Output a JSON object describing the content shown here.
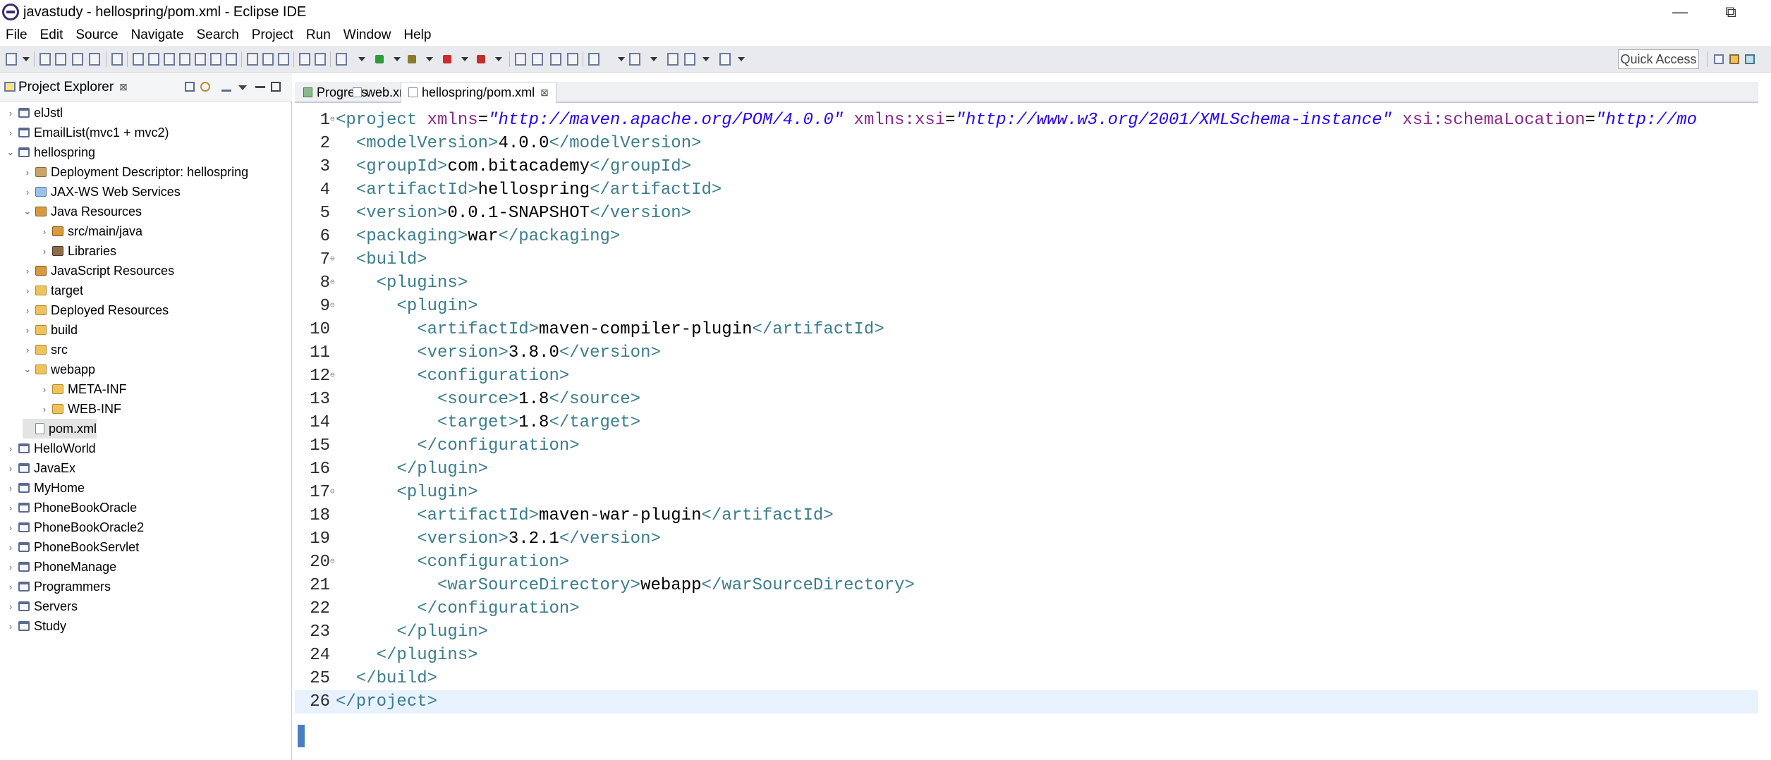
{
  "window": {
    "title": "javastudy - hellospring/pom.xml - Eclipse IDE",
    "minimize_glyph": "—",
    "restore_glyph": "⧉"
  },
  "menu": [
    "File",
    "Edit",
    "Source",
    "Navigate",
    "Search",
    "Project",
    "Run",
    "Window",
    "Help"
  ],
  "toolbar": {
    "quick_access": "Quick Access"
  },
  "explorer": {
    "title": "Project Explorer",
    "close_glyph": "⊠",
    "items": [
      {
        "label": "elJstl",
        "depth": 0,
        "expanded": false,
        "icon": "project-icon"
      },
      {
        "label": "EmailList(mvc1 + mvc2)",
        "depth": 0,
        "expanded": false,
        "icon": "project-icon"
      },
      {
        "label": "hellospring",
        "depth": 0,
        "expanded": true,
        "icon": "project-icon"
      },
      {
        "label": "Deployment Descriptor: hellospring",
        "depth": 1,
        "expanded": false,
        "icon": "deployment-descriptor-icon"
      },
      {
        "label": "JAX-WS Web Services",
        "depth": 1,
        "expanded": false,
        "icon": "web-services-icon"
      },
      {
        "label": "Java Resources",
        "depth": 1,
        "expanded": true,
        "icon": "java-resources-icon"
      },
      {
        "label": "src/main/java",
        "depth": 2,
        "expanded": false,
        "icon": "source-folder-icon"
      },
      {
        "label": "Libraries",
        "depth": 2,
        "expanded": false,
        "icon": "libraries-icon"
      },
      {
        "label": "JavaScript Resources",
        "depth": 1,
        "expanded": false,
        "icon": "javascript-resources-icon"
      },
      {
        "label": "target",
        "depth": 1,
        "expanded": false,
        "icon": "folder-icon"
      },
      {
        "label": "Deployed Resources",
        "depth": 1,
        "expanded": false,
        "icon": "deployed-resources-icon"
      },
      {
        "label": "build",
        "depth": 1,
        "expanded": false,
        "icon": "folder-icon"
      },
      {
        "label": "src",
        "depth": 1,
        "expanded": false,
        "icon": "folder-icon"
      },
      {
        "label": "webapp",
        "depth": 1,
        "expanded": true,
        "icon": "folder-icon"
      },
      {
        "label": "META-INF",
        "depth": 2,
        "expanded": false,
        "icon": "folder-icon"
      },
      {
        "label": "WEB-INF",
        "depth": 2,
        "expanded": false,
        "icon": "folder-icon"
      },
      {
        "label": "pom.xml",
        "depth": 1,
        "expanded": null,
        "icon": "xml-file-icon",
        "selected": true
      },
      {
        "label": "HelloWorld",
        "depth": 0,
        "expanded": false,
        "icon": "project-icon"
      },
      {
        "label": "JavaEx",
        "depth": 0,
        "expanded": false,
        "icon": "project-icon"
      },
      {
        "label": "MyHome",
        "depth": 0,
        "expanded": false,
        "icon": "project-icon"
      },
      {
        "label": "PhoneBookOracle",
        "depth": 0,
        "expanded": false,
        "icon": "project-icon"
      },
      {
        "label": "PhoneBookOracle2",
        "depth": 0,
        "expanded": false,
        "icon": "project-icon"
      },
      {
        "label": "PhoneBookServlet",
        "depth": 0,
        "expanded": false,
        "icon": "project-icon"
      },
      {
        "label": "PhoneManage",
        "depth": 0,
        "expanded": false,
        "icon": "project-icon"
      },
      {
        "label": "Programmers",
        "depth": 0,
        "expanded": false,
        "icon": "project-icon"
      },
      {
        "label": "Servers",
        "depth": 0,
        "expanded": false,
        "icon": "project-icon"
      },
      {
        "label": "Study",
        "depth": 0,
        "expanded": false,
        "icon": "project-icon"
      }
    ]
  },
  "editor": {
    "tabs": [
      {
        "label": "Progress",
        "active": false,
        "icon": "progress-icon"
      },
      {
        "label": "web.xml",
        "active": false,
        "icon": "xml-file-icon"
      },
      {
        "label": "hellospring/pom.xml",
        "active": true,
        "icon": "xml-file-icon",
        "close_glyph": "⊠"
      }
    ],
    "current_line": 26,
    "lines": [
      {
        "n": "1",
        "fold": true,
        "segs": [
          [
            "tg",
            "<project "
          ],
          [
            "at",
            "xmlns"
          ],
          [
            "tx",
            "="
          ],
          [
            "av",
            "\"http://maven.apache.org/POM/4.0.0\""
          ],
          [
            "tx",
            " "
          ],
          [
            "at",
            "xmlns:xsi"
          ],
          [
            "tx",
            "="
          ],
          [
            "av",
            "\"http://www.w3.org/2001/XMLSchema-instance\""
          ],
          [
            "tx",
            " "
          ],
          [
            "at",
            "xsi:schemaLocation"
          ],
          [
            "tx",
            "="
          ],
          [
            "av",
            "\"http://mo"
          ]
        ]
      },
      {
        "n": "2",
        "segs": [
          [
            "tx",
            "  "
          ],
          [
            "tg",
            "<modelVersion>"
          ],
          [
            "tx",
            "4.0.0"
          ],
          [
            "tg",
            "</modelVersion>"
          ]
        ]
      },
      {
        "n": "3",
        "segs": [
          [
            "tx",
            "  "
          ],
          [
            "tg",
            "<groupId>"
          ],
          [
            "tx",
            "com.bitacademy"
          ],
          [
            "tg",
            "</groupId>"
          ]
        ]
      },
      {
        "n": "4",
        "segs": [
          [
            "tx",
            "  "
          ],
          [
            "tg",
            "<artifactId>"
          ],
          [
            "tx",
            "hellospring"
          ],
          [
            "tg",
            "</artifactId>"
          ]
        ]
      },
      {
        "n": "5",
        "segs": [
          [
            "tx",
            "  "
          ],
          [
            "tg",
            "<version>"
          ],
          [
            "tx",
            "0.0.1-SNAPSHOT"
          ],
          [
            "tg",
            "</version>"
          ]
        ]
      },
      {
        "n": "6",
        "segs": [
          [
            "tx",
            "  "
          ],
          [
            "tg",
            "<packaging>"
          ],
          [
            "tx",
            "war"
          ],
          [
            "tg",
            "</packaging>"
          ]
        ]
      },
      {
        "n": "7",
        "fold": true,
        "segs": [
          [
            "tx",
            "  "
          ],
          [
            "tg",
            "<build>"
          ]
        ]
      },
      {
        "n": "8",
        "fold": true,
        "segs": [
          [
            "tx",
            "    "
          ],
          [
            "tg",
            "<plugins>"
          ]
        ]
      },
      {
        "n": "9",
        "fold": true,
        "segs": [
          [
            "tx",
            "      "
          ],
          [
            "tg",
            "<plugin>"
          ]
        ]
      },
      {
        "n": "10",
        "segs": [
          [
            "tx",
            "        "
          ],
          [
            "tg",
            "<artifactId>"
          ],
          [
            "tx",
            "maven-compiler-plugin"
          ],
          [
            "tg",
            "</artifactId>"
          ]
        ]
      },
      {
        "n": "11",
        "segs": [
          [
            "tx",
            "        "
          ],
          [
            "tg",
            "<version>"
          ],
          [
            "tx",
            "3.8.0"
          ],
          [
            "tg",
            "</version>"
          ]
        ]
      },
      {
        "n": "12",
        "fold": true,
        "segs": [
          [
            "tx",
            "        "
          ],
          [
            "tg",
            "<configuration>"
          ]
        ]
      },
      {
        "n": "13",
        "segs": [
          [
            "tx",
            "          "
          ],
          [
            "tg",
            "<source>"
          ],
          [
            "tx",
            "1.8"
          ],
          [
            "tg",
            "</source>"
          ]
        ]
      },
      {
        "n": "14",
        "segs": [
          [
            "tx",
            "          "
          ],
          [
            "tg",
            "<target>"
          ],
          [
            "tx",
            "1.8"
          ],
          [
            "tg",
            "</target>"
          ]
        ]
      },
      {
        "n": "15",
        "segs": [
          [
            "tx",
            "        "
          ],
          [
            "tg",
            "</configuration>"
          ]
        ]
      },
      {
        "n": "16",
        "segs": [
          [
            "tx",
            "      "
          ],
          [
            "tg",
            "</plugin>"
          ]
        ]
      },
      {
        "n": "17",
        "fold": true,
        "segs": [
          [
            "tx",
            "      "
          ],
          [
            "tg",
            "<plugin>"
          ]
        ]
      },
      {
        "n": "18",
        "segs": [
          [
            "tx",
            "        "
          ],
          [
            "tg",
            "<artifactId>"
          ],
          [
            "tx",
            "maven-war-plugin"
          ],
          [
            "tg",
            "</artifactId>"
          ]
        ]
      },
      {
        "n": "19",
        "segs": [
          [
            "tx",
            "        "
          ],
          [
            "tg",
            "<version>"
          ],
          [
            "tx",
            "3.2.1"
          ],
          [
            "tg",
            "</version>"
          ]
        ]
      },
      {
        "n": "20",
        "fold": true,
        "segs": [
          [
            "tx",
            "        "
          ],
          [
            "tg",
            "<configuration>"
          ]
        ]
      },
      {
        "n": "21",
        "segs": [
          [
            "tx",
            "          "
          ],
          [
            "tg",
            "<warSourceDirectory>"
          ],
          [
            "tx",
            "webapp"
          ],
          [
            "tg",
            "</warSourceDirectory>"
          ]
        ]
      },
      {
        "n": "22",
        "segs": [
          [
            "tx",
            "        "
          ],
          [
            "tg",
            "</configuration>"
          ]
        ]
      },
      {
        "n": "23",
        "segs": [
          [
            "tx",
            "      "
          ],
          [
            "tg",
            "</plugin>"
          ]
        ]
      },
      {
        "n": "24",
        "segs": [
          [
            "tx",
            "    "
          ],
          [
            "tg",
            "</plugins>"
          ]
        ]
      },
      {
        "n": "25",
        "segs": [
          [
            "tx",
            "  "
          ],
          [
            "tg",
            "</build>"
          ]
        ]
      },
      {
        "n": "26",
        "segs": [
          [
            "tg",
            "</project>"
          ]
        ]
      }
    ]
  }
}
